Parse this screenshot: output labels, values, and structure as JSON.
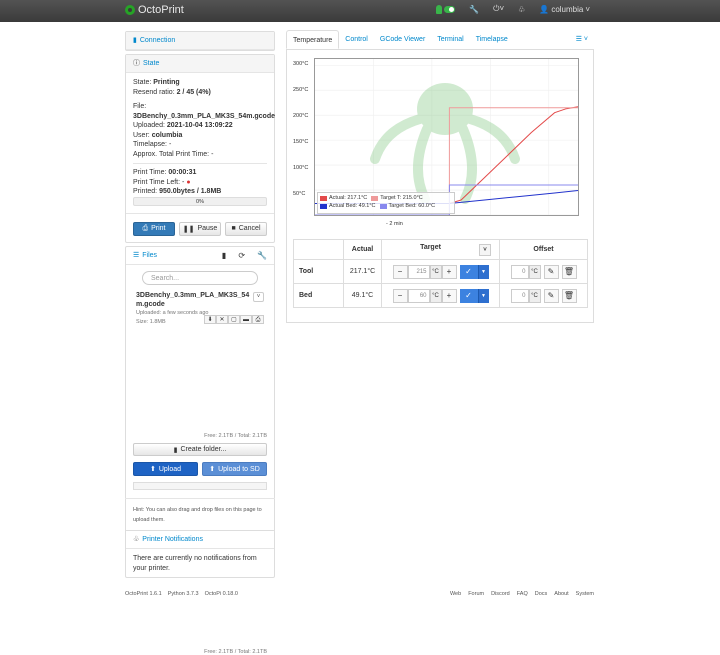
{
  "nav": {
    "brand": "OctoPrint",
    "user": "columbia"
  },
  "connection": {
    "title": "Connection"
  },
  "state": {
    "title": "State",
    "state_label": "State:",
    "state_value": "Printing",
    "resend_label": "Resend ratio:",
    "resend_value": "2 / 45 (4%)",
    "file_label": "File:",
    "file_value": "3DBenchy_0.3mm_PLA_MK3S_54m.gcode",
    "uploaded_label": "Uploaded:",
    "uploaded_value": "2021-10-04 13:09:22",
    "user_label": "User:",
    "user_value": "columbia",
    "timelapse_label": "Timelapse:",
    "timelapse_value": "-",
    "approx_label": "Approx. Total Print Time:",
    "approx_value": "-",
    "printtime_label": "Print Time:",
    "printtime_value": "00:00:31",
    "timeleft_label": "Print Time Left:",
    "timeleft_value": "-",
    "printed_label": "Printed:",
    "printed_value": "950.0bytes / 1.8MB",
    "progress_text": "0%",
    "progress": 0.0,
    "buttons": {
      "print": "Print",
      "pause": "Pause",
      "cancel": "Cancel"
    }
  },
  "files": {
    "title": "Files",
    "search_placeholder": "Search...",
    "item": {
      "name": "3DBenchy_0.3mm_PLA_MK3S_54m.gcode",
      "uploaded": "Uploaded: a few seconds ago",
      "size": "Size: 1.8MB"
    },
    "free": "Free: 2.1TB / Total: 2.1TB",
    "create_folder": "Create folder...",
    "upload": "Upload",
    "upload_sd": "Upload to SD",
    "hint": "Hint: You can also drag and drop files on this page to upload them."
  },
  "notifications": {
    "title": "Printer Notifications",
    "text": "There are currently no notifications from your printer."
  },
  "tabs": [
    "Temperature",
    "Control",
    "GCode Viewer",
    "Terminal",
    "Timelapse"
  ],
  "chart_data": {
    "type": "line",
    "y_ticks": [
      "300°C",
      "250°C",
      "200°C",
      "150°C",
      "100°C",
      "50°C"
    ],
    "ylim": [
      0,
      300
    ],
    "xlim": [
      -4.5,
      0
    ],
    "xlabel": "- 2 min",
    "series": [
      {
        "name": "Actual: 217.1°C",
        "color": "#e34a4a",
        "x": [
          -4.5,
          -2.2,
          -2.0,
          -1.6,
          -1.2,
          -0.8,
          -0.4,
          -0.2,
          0
        ],
        "y": [
          23,
          23,
          30,
          75,
          120,
          165,
          205,
          213,
          217
        ]
      },
      {
        "name": "Target T: 215.0°C",
        "color": "#ef9a9a",
        "x": [
          -4.5,
          -2.2,
          -2.2,
          0
        ],
        "y": [
          0,
          0,
          215,
          215
        ]
      },
      {
        "name": "Actual Bed: 49.1°C",
        "color": "#2233cc",
        "x": [
          -4.5,
          -2.2,
          -1.6,
          -1.0,
          -0.4,
          0
        ],
        "y": [
          23,
          23,
          30,
          37,
          44,
          49
        ]
      },
      {
        "name": "Target Bed: 60.0°C",
        "color": "#8888ee",
        "x": [
          -4.5,
          -2.2,
          -2.2,
          0
        ],
        "y": [
          0,
          0,
          60,
          60
        ]
      }
    ]
  },
  "temp_table": {
    "headers": [
      "",
      "Actual",
      "Target",
      "Offset"
    ],
    "rows": [
      {
        "name": "Tool",
        "actual": "217.1°C",
        "target": "215",
        "offset": "0"
      },
      {
        "name": "Bed",
        "actual": "49.1°C",
        "target": "60",
        "offset": "0"
      }
    ],
    "unit": "°C"
  },
  "footer": {
    "left": [
      "OctoPrint 1.6.1",
      "Python 3.7.3",
      "OctoPi 0.18.0"
    ],
    "right": [
      "Web",
      "Forum",
      "Discord",
      "FAQ",
      "Docs",
      "About",
      "System"
    ]
  }
}
